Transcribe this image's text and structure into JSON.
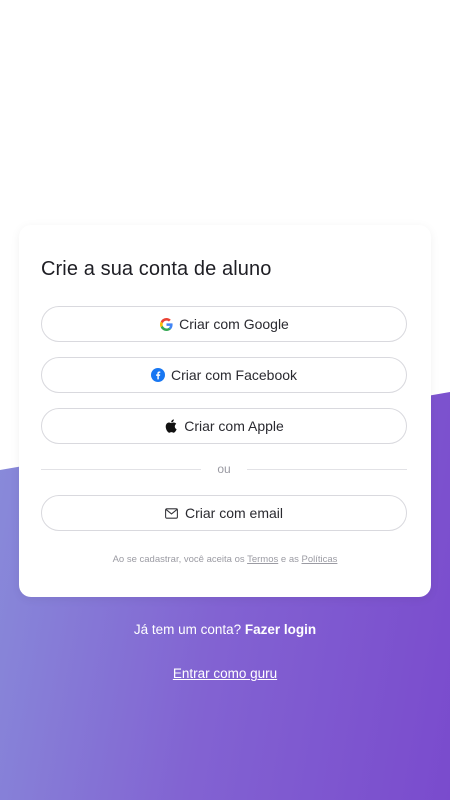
{
  "card": {
    "title": "Crie a sua conta de aluno",
    "buttons": {
      "google": {
        "label": "Criar com Google",
        "icon": "google-icon"
      },
      "facebook": {
        "label": "Criar com Facebook",
        "icon": "facebook-icon"
      },
      "apple": {
        "label": "Criar com Apple",
        "icon": "apple-icon"
      },
      "email": {
        "label": "Criar com email",
        "icon": "mail-icon"
      }
    },
    "divider_text": "ou",
    "terms": {
      "prefix": "Ao se cadastrar, você aceita os",
      "terms_link": "Termos",
      "middle": "e as",
      "policies_link": "Políticas"
    }
  },
  "footer": {
    "login_prompt": "Já tem um conta?",
    "login_link": "Fazer login",
    "guru_link": "Entrar como guru"
  },
  "colors": {
    "gradient_start": "#8a97dc",
    "gradient_end": "#7a4bcd",
    "facebook_blue": "#1877f2"
  }
}
